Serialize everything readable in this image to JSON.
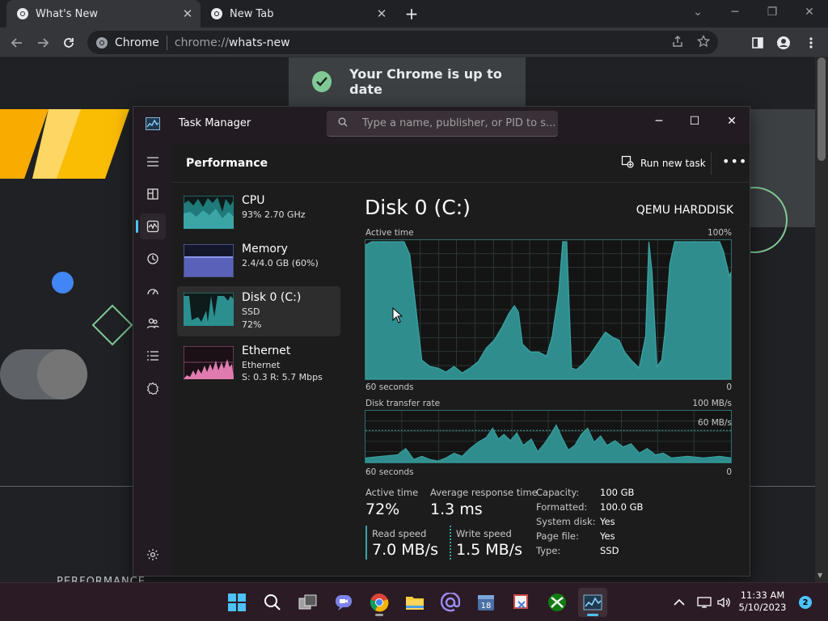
{
  "browser": {
    "tabs": [
      {
        "title": "What's New",
        "active": true
      },
      {
        "title": "New Tab",
        "active": false
      }
    ],
    "omnibox": {
      "site_label": "Chrome",
      "url_scheme": "chrome://",
      "url_path": "whats-new"
    },
    "page": {
      "banner_text": "Your Chrome is up to date",
      "bottom_text": "PERFORMANCE"
    }
  },
  "task_manager": {
    "window_title": "Task Manager",
    "search_placeholder": "Type a name, publisher, or PID to s...",
    "page_title": "Performance",
    "run_new_task": "Run new task",
    "more": "•••",
    "resources": [
      {
        "name": "CPU",
        "line1": "93% 2.70 GHz",
        "line2": ""
      },
      {
        "name": "Memory",
        "line1": "2.4/4.0 GB (60%)",
        "line2": ""
      },
      {
        "name": "Disk 0 (C:)",
        "line1": "SSD",
        "line2": "72%"
      },
      {
        "name": "Ethernet",
        "line1": "Ethernet",
        "line2": "S: 0.3 R: 5.7 Mbps"
      }
    ],
    "detail": {
      "title": "Disk 0 (C:)",
      "model": "QEMU HARDDISK",
      "graph1": {
        "label": "Active time",
        "max": "100%",
        "x_label": "60 seconds",
        "min": "0"
      },
      "graph2": {
        "label": "Disk transfer rate",
        "max": "100 MB/s",
        "mid": "60 MB/s",
        "x_label": "60 seconds",
        "min": "0"
      },
      "stats": {
        "active_time_label": "Active time",
        "active_time": "72%",
        "avg_response_label": "Average response time",
        "avg_response": "1.3 ms",
        "read_label": "Read speed",
        "read": "7.0 MB/s",
        "write_label": "Write speed",
        "write": "1.5 MB/s"
      },
      "properties": [
        {
          "key": "Capacity:",
          "value": "100 GB"
        },
        {
          "key": "Formatted:",
          "value": "100.0 GB"
        },
        {
          "key": "System disk:",
          "value": "Yes"
        },
        {
          "key": "Page file:",
          "value": "Yes"
        },
        {
          "key": "Type:",
          "value": "SSD"
        }
      ]
    },
    "colors": {
      "disk_graph": "#3aa5a4",
      "memory_graph": "#7a86d8",
      "ethernet_graph": "#e07bb0",
      "accent": "#4cc2ff"
    }
  },
  "taskbar": {
    "clock_time": "11:33 AM",
    "clock_date": "5/10/2023",
    "notification_count": "2",
    "calendar_badge": "18",
    "apps": [
      "start-icon",
      "search-icon",
      "task-view-icon",
      "chat-icon",
      "chrome-icon",
      "file-explorer-icon",
      "mail-icon",
      "calendar-icon",
      "snipping-tool-icon",
      "xbox-icon",
      "task-manager-icon"
    ]
  }
}
